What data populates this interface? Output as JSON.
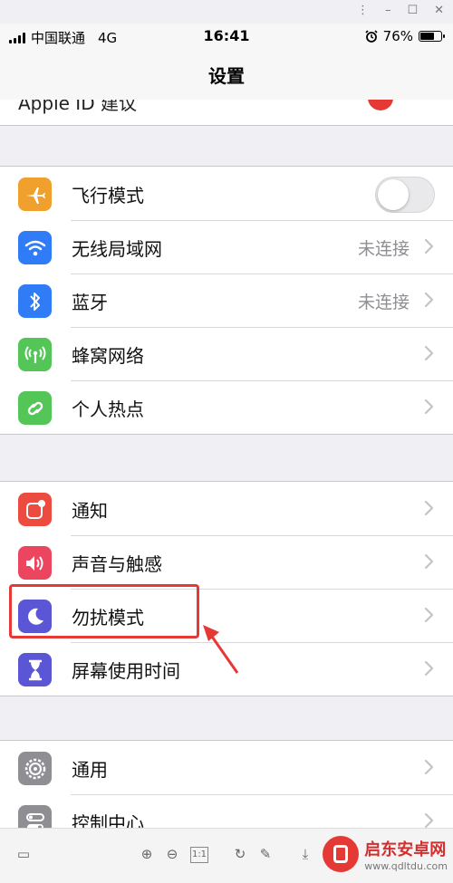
{
  "window": {
    "controls": [
      "⋮",
      "–",
      "☐",
      "✕"
    ]
  },
  "status": {
    "carrier": "中国联通",
    "network": "4G",
    "time": "16:41",
    "battery": "76%",
    "battery_level": 0.76
  },
  "nav": {
    "title": "设置"
  },
  "clipped_row": {
    "label": "Apple ID 建议"
  },
  "group1": [
    {
      "label": "飞行模式",
      "icon": "airplane-icon",
      "color": "#f0a02c",
      "control": "toggle",
      "on": false
    },
    {
      "label": "无线局域网",
      "icon": "wifi-icon",
      "color": "#2f7cf6",
      "value": "未连接"
    },
    {
      "label": "蓝牙",
      "icon": "bluetooth-icon",
      "color": "#2f7cf6",
      "value": "未连接"
    },
    {
      "label": "蜂窝网络",
      "icon": "cellular-icon",
      "color": "#53c657"
    },
    {
      "label": "个人热点",
      "icon": "hotspot-icon",
      "color": "#53c657"
    }
  ],
  "group2": [
    {
      "label": "通知",
      "icon": "notification-icon",
      "color": "#ec4b3f"
    },
    {
      "label": "声音与触感",
      "icon": "sound-icon",
      "color": "#ec4560"
    },
    {
      "label": "勿扰模式",
      "icon": "moon-icon",
      "color": "#5a56d6"
    },
    {
      "label": "屏幕使用时间",
      "icon": "hourglass-icon",
      "color": "#5a56d6"
    }
  ],
  "group3": [
    {
      "label": "通用",
      "icon": "gear-icon",
      "color": "#8e8e93"
    },
    {
      "label": "控制中心",
      "icon": "control-center-icon",
      "color": "#8e8e93"
    }
  ],
  "watermark": {
    "name": "启东安卓网",
    "url": "www.qdltdu.com"
  }
}
